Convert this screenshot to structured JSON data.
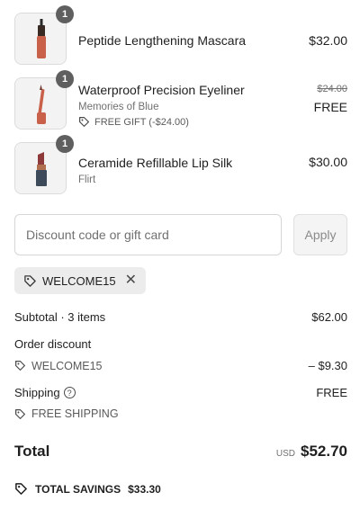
{
  "items": [
    {
      "quantity": "1",
      "title": "Peptide Lengthening Mascara",
      "variant": "",
      "gift_label": "",
      "original_price": "",
      "price": "$32.00",
      "product_image": "mascara-tube"
    },
    {
      "quantity": "1",
      "title": "Waterproof Precision Eyeliner",
      "variant": "Memories of Blue",
      "gift_label": "FREE GIFT (-$24.00)",
      "original_price": "$24.00",
      "price": "FREE",
      "product_image": "eyeliner-pencil"
    },
    {
      "quantity": "1",
      "title": "Ceramide Refillable Lip Silk",
      "variant": "Flirt",
      "gift_label": "",
      "original_price": "",
      "price": "$30.00",
      "product_image": "lipstick"
    }
  ],
  "discount": {
    "placeholder": "Discount code or gift card",
    "value": "",
    "apply_label": "Apply",
    "applied_code": "WELCOME15"
  },
  "summary": {
    "subtotal_label": "Subtotal · 3 items",
    "subtotal_value": "$62.00",
    "order_discount_label": "Order discount",
    "order_discount_code": "WELCOME15",
    "order_discount_value": "– $9.30",
    "shipping_label": "Shipping",
    "shipping_value": "FREE",
    "shipping_code": "FREE SHIPPING",
    "total_label": "Total",
    "currency": "USD",
    "total_value": "$52.70",
    "savings_label": "TOTAL SAVINGS",
    "savings_value": "$33.30"
  },
  "colors": {
    "product_accent": "#c8604a",
    "badge": "#5f5f5f",
    "text": "#1f1f1f",
    "muted": "#707070"
  }
}
